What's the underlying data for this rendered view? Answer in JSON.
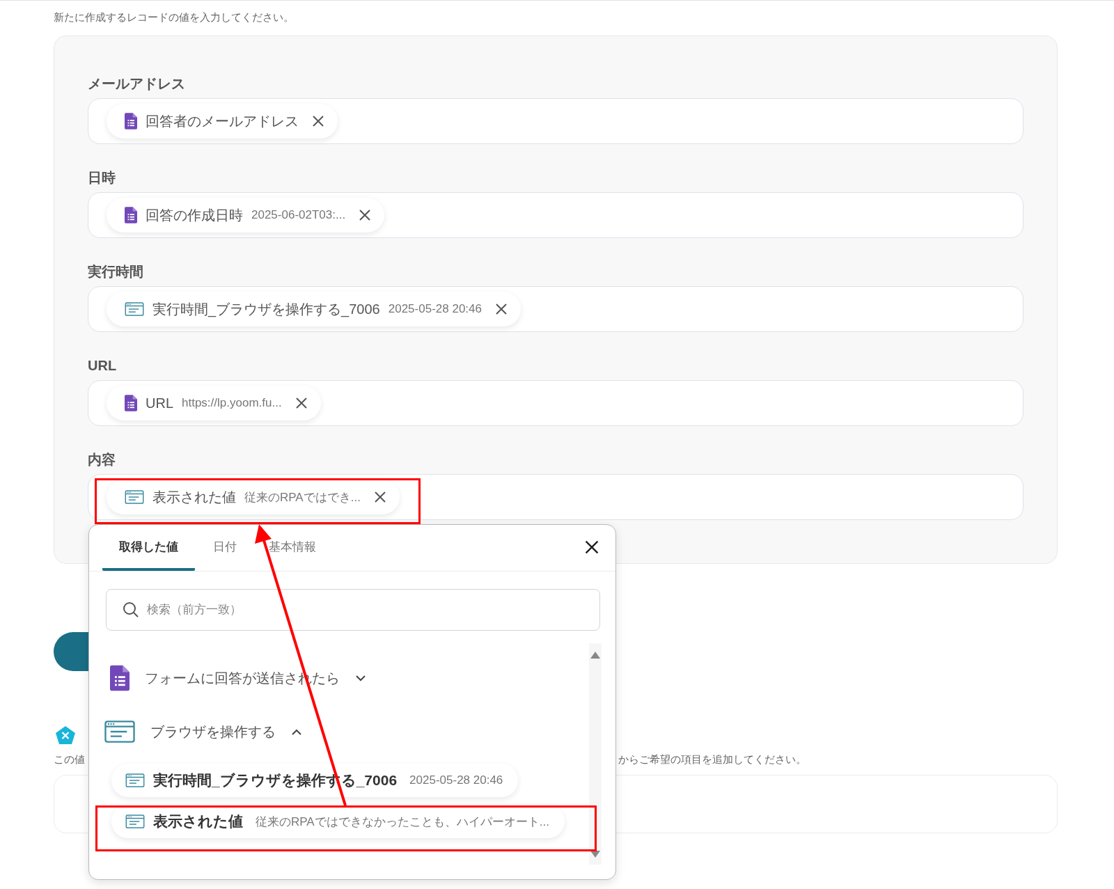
{
  "instruction": "新たに作成するレコードの値を入力してください。",
  "fields": [
    {
      "label": "メールアドレス",
      "chips": [
        {
          "kind": "form",
          "name": "回答者のメールアドレス"
        }
      ]
    },
    {
      "label": "日時",
      "chips": [
        {
          "kind": "form",
          "name": "回答の作成日時",
          "value": "2025-06-02T03:..."
        }
      ]
    },
    {
      "label": "実行時間",
      "chips": [
        {
          "kind": "browser",
          "name": "実行時間_ブラウザを操作する_7006",
          "value": "2025-05-28 20:46"
        }
      ]
    },
    {
      "label": "URL",
      "chips": [
        {
          "kind": "form",
          "name": "URL",
          "value": "https://lp.yoom.fu..."
        }
      ]
    },
    {
      "label": "内容",
      "chips": [
        {
          "kind": "browser",
          "name": "表示された値",
          "value": "従来のRPAではでき..."
        }
      ]
    }
  ],
  "notes": {
    "left": "この値",
    "right": "からご希望の項目を追加してください。"
  },
  "popup": {
    "tabs": [
      {
        "label": "取得した値",
        "selected": true
      },
      {
        "label": "日付",
        "selected": false
      },
      {
        "label": "基本情報",
        "selected": false
      }
    ],
    "search": {
      "placeholder": "検索（前方一致）"
    },
    "groups": [
      {
        "kind": "form",
        "title": "フォームに回答が送信されたら",
        "expanded": false
      },
      {
        "kind": "browser",
        "title": "ブラウザを操作する",
        "expanded": true,
        "items": [
          {
            "kind": "browser",
            "name": "実行時間_ブラウザを操作する_7006",
            "value": "2025-05-28 20:46"
          },
          {
            "kind": "browser",
            "name": "表示された値",
            "value": "従来のRPAではできなかったことも、ハイパーオート..."
          }
        ]
      }
    ]
  }
}
